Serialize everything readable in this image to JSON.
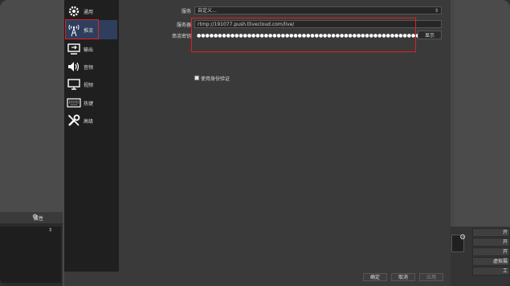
{
  "sidebar": {
    "items": [
      {
        "label": "通用",
        "icon": "gear-icon"
      },
      {
        "label": "推流",
        "icon": "broadcast-icon"
      },
      {
        "label": "输出",
        "icon": "output-icon"
      },
      {
        "label": "音频",
        "icon": "speaker-icon"
      },
      {
        "label": "视频",
        "icon": "monitor-icon"
      },
      {
        "label": "热键",
        "icon": "keyboard-icon"
      },
      {
        "label": "高级",
        "icon": "tools-icon"
      }
    ]
  },
  "stream": {
    "service_label": "服务",
    "service_value": "自定义...",
    "server_label": "服务器",
    "server_value": "rtmp://191077.push.tlivecloud.com/live/",
    "key_label": "串流密钥",
    "key_value": "●●●●●●●●●●●●●●●●●●●●●●●●●●●●●●●●●●●●●●●●●●●●●●●●●●●●●●●●●",
    "show_label": "显示",
    "auth_label": "使用身份验证"
  },
  "footer": {
    "ok": "确定",
    "cancel": "取消",
    "apply": "应用"
  },
  "background": {
    "properties_label": "属性",
    "right_buttons": [
      "开",
      "开",
      "开",
      "虚拟摄",
      "工"
    ]
  },
  "colors": {
    "highlight": "#e02020",
    "active_nav": "#2e3e5c"
  }
}
